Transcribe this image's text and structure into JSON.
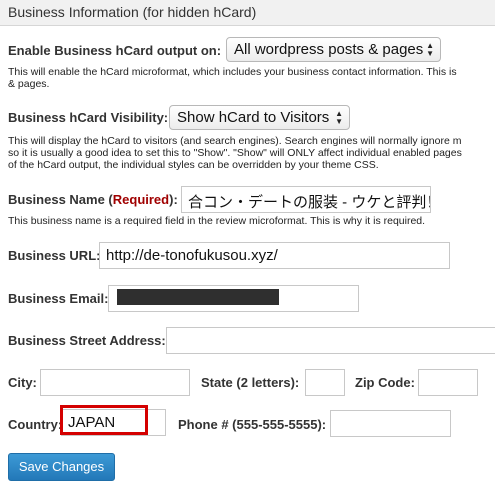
{
  "panel": {
    "title": "Business Information (for hidden hCard)"
  },
  "hcard_output": {
    "label": "Enable Business hCard output on:",
    "selected": "All wordpress posts & pages",
    "description": [
      "This will enable the hCard microformat, which includes your business contact information. This is",
      "& pages."
    ]
  },
  "hcard_visibility": {
    "label": "Business hCard Visibility:",
    "selected": "Show hCard to Visitors",
    "description": [
      "This will display the hCard to visitors (and search engines). Search engines will normally ignore m",
      "so it is usually a good idea to set this to \"Show\". \"Show\" will ONLY affect individual enabled pages",
      "of the hCard output, the individual styles can be overridden by your theme CSS."
    ]
  },
  "business_name": {
    "label": "Business Name (",
    "required": "Required",
    "label_end": "):",
    "value": "合コン・デートの服装 - ウケと評判！",
    "description": "This business name is a required field in the review microformat. This is why it is required."
  },
  "business_url": {
    "label": "Business URL:",
    "value": "http://de-tonofukusou.xyz/"
  },
  "business_email": {
    "label": "Business Email:",
    "value": ""
  },
  "street": {
    "label": "Business Street Address:",
    "value": ""
  },
  "city": {
    "label": "City:",
    "value": ""
  },
  "state": {
    "label": "State (2 letters):",
    "value": ""
  },
  "zip": {
    "label": "Zip Code:",
    "value": ""
  },
  "country": {
    "label": "Country:",
    "value": "JAPAN"
  },
  "phone": {
    "label": "Phone # (555-555-5555):",
    "value": ""
  },
  "save_label": "Save Changes"
}
